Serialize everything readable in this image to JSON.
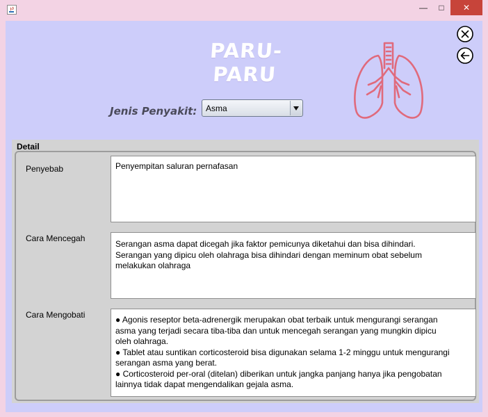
{
  "window": {
    "minimize_glyph": "—",
    "maximize_glyph": "□",
    "close_glyph": "✕"
  },
  "header": {
    "title": "PARU-PARU",
    "disease_label": "Jenis Penyakit:",
    "disease_selected": "Asma",
    "accent_color": "#e06a7c"
  },
  "detail": {
    "title": "Detail",
    "sections": [
      {
        "label": "Penyebab",
        "lines": [
          "Penyempitan saluran pernafasan"
        ]
      },
      {
        "label": "Cara Mencegah",
        "lines": [
          "Serangan asma dapat dicegah jika faktor pemicunya diketahui dan bisa dihindari.",
          "Serangan yang dipicu oleh olahraga bisa dihindari dengan meminum obat sebelum",
          "melakukan olahraga"
        ]
      },
      {
        "label": "Cara Mengobati",
        "lines": [
          "● Agonis reseptor beta-adrenergik merupakan obat terbaik untuk mengurangi serangan",
          " asma yang terjadi secara tiba-tiba dan untuk mencegah serangan yang mungkin dipicu",
          "oleh olahraga.",
          "● Tablet atau suntikan corticosteroid bisa digunakan selama 1-2 minggu untuk mengurangi",
          "serangan asma yang berat.",
          "● Corticosteroid per-oral (ditelan) diberikan untuk jangka panjang hanya jika pengobatan",
          "lainnya tidak dapat mengendalikan gejala asma."
        ]
      }
    ]
  }
}
